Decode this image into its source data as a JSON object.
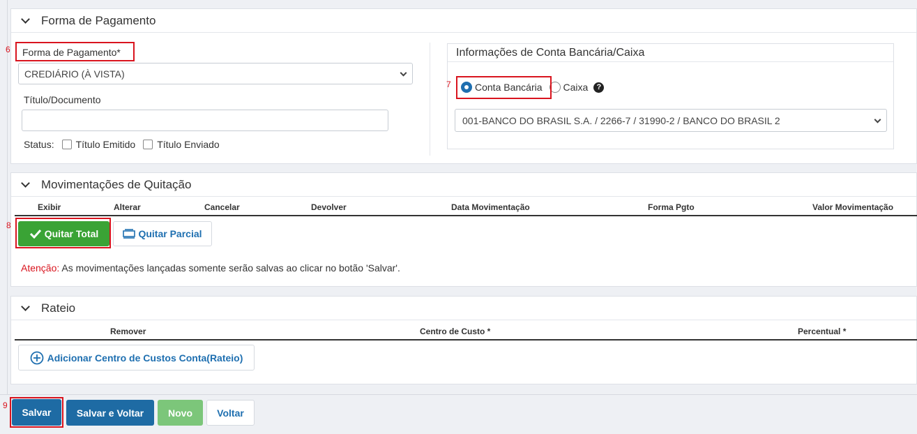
{
  "section_payment": {
    "title": "Forma de Pagamento",
    "payment_method_label": "Forma de Pagamento*",
    "payment_method_value": "CREDIÁRIO (À VISTA)",
    "title_document_label": "Título/Documento",
    "title_document_value": "",
    "status_label": "Status:",
    "checkbox_issued": "Título Emitido",
    "checkbox_sent": "Título Enviado",
    "bank_box_title": "Informações de Conta Bancária/Caixa",
    "radio_bank": "Conta Bancária",
    "radio_cash": "Caixa",
    "bank_account_value": "001-BANCO DO BRASIL S.A. / 2266-7 / 31990-2 / BANCO DO BRASIL 2"
  },
  "section_movements": {
    "title": "Movimentações de Quitação",
    "columns": [
      "Exibir",
      "Alterar",
      "Cancelar",
      "Devolver",
      "Data Movimentação",
      "Forma Pgto",
      "Valor Movimentação"
    ],
    "btn_total": "Quitar Total",
    "btn_partial": "Quitar Parcial",
    "warning_label": "Atenção:",
    "warning_text": "As movimentações lançadas somente serão salvas ao clicar no botão 'Salvar'."
  },
  "section_rateio": {
    "title": "Rateio",
    "columns": [
      "Remover",
      "Centro de Custo *",
      "Percentual *"
    ],
    "btn_add": "Adicionar Centro de Custos Conta(Rateio)"
  },
  "footer": {
    "save": "Salvar",
    "save_back": "Salvar e Voltar",
    "new": "Novo",
    "back": "Voltar"
  },
  "step_marks": [
    "6",
    "7",
    "8",
    "9"
  ],
  "colors": {
    "primary": "#1e6ba4",
    "success": "#3aa335",
    "disabled_success": "#7cc67a",
    "highlight": "#d9141e",
    "link": "#1e6fb0"
  }
}
